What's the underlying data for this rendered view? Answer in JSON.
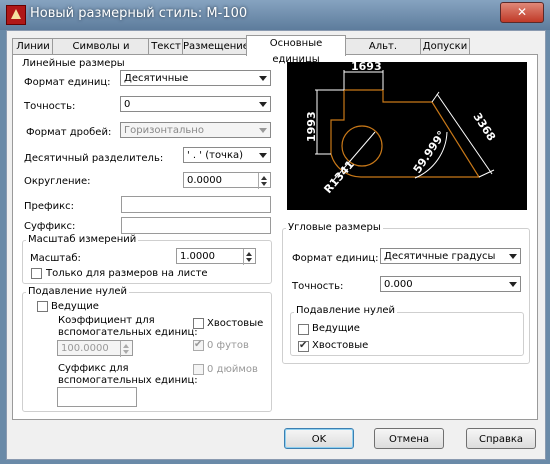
{
  "window": {
    "title": "Новый размерный стиль: М-100",
    "close_glyph": "✕"
  },
  "tabs": [
    "Линии",
    "Символы и стрелки",
    "Текст",
    "Размещение",
    "Основные единицы",
    "Альт. единицы",
    "Допуски"
  ],
  "linear": {
    "title": "Линейные размеры",
    "unit_format_label": "Формат единиц:",
    "unit_format_value": "Десятичные",
    "precision_label": "Точность:",
    "precision_value": "0",
    "fraction_format_label": "Формат дробей:",
    "fraction_format_value": "Горизонтально",
    "decimal_separator_label": "Десятичный  разделитель:",
    "decimal_separator_value": "' . ' (точка)",
    "rounding_label": "Округление:",
    "rounding_value": "0.0000",
    "prefix_label": "Префикс:",
    "prefix_value": "",
    "suffix_label": "Суффикс:",
    "suffix_value": ""
  },
  "scale": {
    "title": "Масштаб измерений",
    "scale_label": "Масштаб:",
    "scale_value": "1.0000",
    "layout_only_label": "Только для размеров на листе",
    "layout_only_checked": false
  },
  "zero_suppression": {
    "title": "Подавление нулей",
    "leading_label": "Ведущие",
    "leading_checked": false,
    "sub_unit_factor_label_1": "Коэффициент для",
    "sub_unit_factor_label_2": "вспомогательных единиц:",
    "sub_unit_factor_value": "100.0000",
    "sub_unit_suffix_label_1": "Суффикс для",
    "sub_unit_suffix_label_2": "вспомогательных единиц:",
    "sub_unit_suffix_value": "",
    "trailing_label": "Хвостовые",
    "trailing_checked": false,
    "feet_label": "0 футов",
    "feet_checked": true,
    "inches_label": "0 дюймов",
    "inches_checked": false
  },
  "preview": {
    "dim_top": "1693",
    "dim_left": "1993",
    "dim_right": "3368",
    "dim_angle": "59.999°",
    "dim_radius": "R1341",
    "colors": {
      "background": "#000000",
      "geometry": "#c87818",
      "dims": "#ffffff"
    }
  },
  "angular": {
    "title": "Угловые размеры",
    "unit_format_label": "Формат единиц:",
    "unit_format_value": "Десятичные градусы",
    "precision_label": "Точность:",
    "precision_value": "0.000",
    "zero_title": "Подавление нулей",
    "leading_label": "Ведущие",
    "leading_checked": false,
    "trailing_label": "Хвостовые",
    "trailing_checked": true
  },
  "buttons": {
    "ok": "OK",
    "cancel": "Отмена",
    "help": "Справка"
  }
}
